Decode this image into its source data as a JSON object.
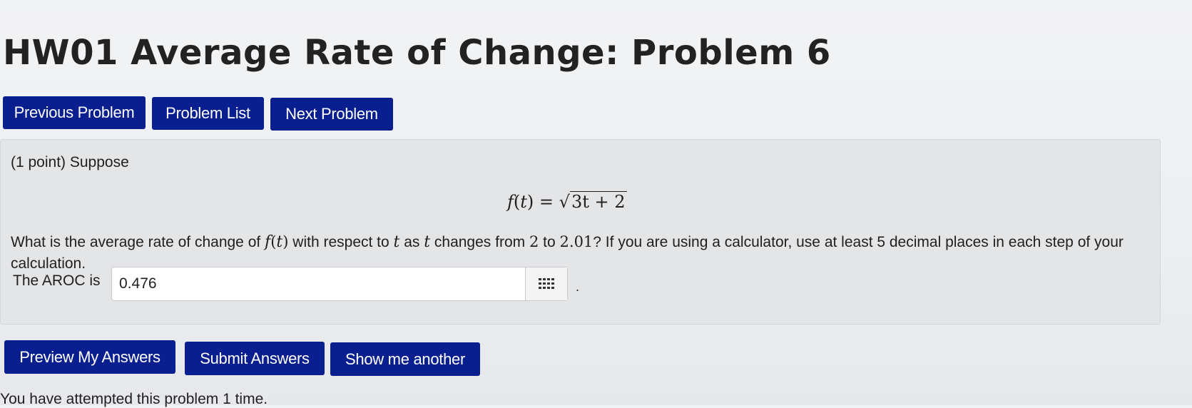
{
  "header": {
    "title": "HW01 Average Rate of Change: Problem 6"
  },
  "nav": {
    "previous_label": "Previous Problem",
    "list_label": "Problem List",
    "next_label": "Next Problem"
  },
  "problem": {
    "intro": "(1 point) Suppose",
    "formula": {
      "lhs_name": "f",
      "lhs_var": "t",
      "equals": "=",
      "radicand": "3t + 2"
    },
    "question": {
      "part1": "What is the average rate of change of ",
      "func_name": "f",
      "func_var": "t",
      "part2": " with respect to ",
      "var1": "t",
      "part3": " as ",
      "var2": "t",
      "part4": " changes from ",
      "from": "2",
      "part5": " to ",
      "to": "2.01",
      "part6": "? If you are using a calculator, use at least 5 decimal places in each step of your calculation."
    },
    "answer_label": "The AROC is",
    "answer_value": "0.476",
    "answer_end": "."
  },
  "actions": {
    "preview_label": "Preview My Answers",
    "submit_label": "Submit Answers",
    "another_label": "Show me another"
  },
  "status": {
    "attempts_text": "You have attempted this problem 1 time."
  },
  "colors": {
    "button_bg": "#0a1f8f",
    "button_text": "#ffffff",
    "panel_bg": "#e4e5e7"
  }
}
